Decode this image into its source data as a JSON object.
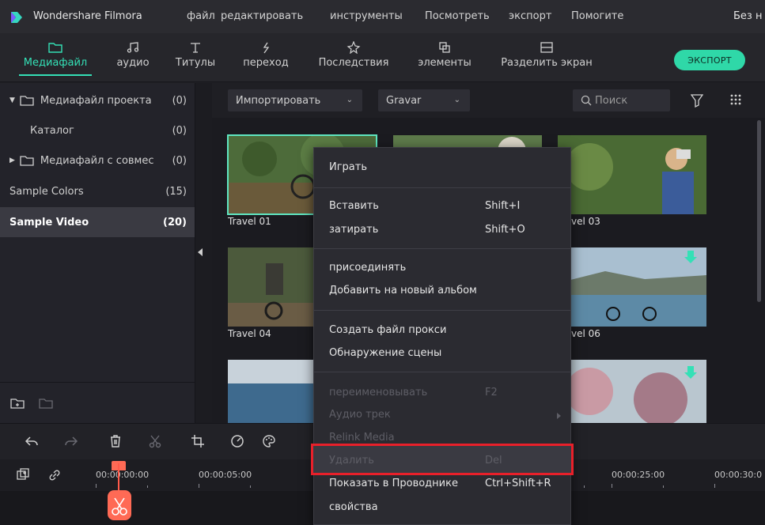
{
  "app": {
    "name": "Wondershare Filmora",
    "untitled": "Без н"
  },
  "menu": [
    "файл",
    "редактировать",
    "инструменты",
    "Посмотреть",
    "экспорт",
    "Помогите"
  ],
  "tabs": [
    {
      "label": "Медиафайл",
      "icon": "folder-icon",
      "active": true
    },
    {
      "label": "аудио",
      "icon": "music-note-icon",
      "active": false
    },
    {
      "label": "Титулы",
      "icon": "text-t-icon",
      "active": false
    },
    {
      "label": "переход",
      "icon": "transition-icon",
      "active": false
    },
    {
      "label": "Последствия",
      "icon": "effects-sparkle-icon",
      "active": false
    },
    {
      "label": "элементы",
      "icon": "elements-icon",
      "active": false
    },
    {
      "label": "Разделить экран",
      "icon": "split-screen-icon",
      "active": false
    }
  ],
  "export_label": "ЭКСПОРТ",
  "library": [
    {
      "label": "Медиафайл проекта",
      "count": "(0)",
      "expand": "▼",
      "folder": true
    },
    {
      "label": "Каталог",
      "count": "(0)",
      "expand": "",
      "folder": false
    },
    {
      "label": "Медиафайл с совмес",
      "count": "(0)",
      "expand": "▶",
      "folder": true
    },
    {
      "label": "Sample Colors",
      "count": "(15)",
      "expand": "",
      "folder": false
    },
    {
      "label": "Sample Video",
      "count": "(20)",
      "expand": "",
      "folder": false,
      "selected": true
    }
  ],
  "media_bar": {
    "import_label": "Импортировать",
    "gravar_label": "Gravar",
    "search_placeholder": "Поиск"
  },
  "thumbnails": [
    {
      "label": "Travel 01"
    },
    {
      "label": "vel 03"
    },
    {
      "label": "Travel 04"
    },
    {
      "label": "vel 06"
    }
  ],
  "context_menu": [
    {
      "label": "Играть",
      "shortcut": "",
      "disabled": false
    },
    {
      "label": "Вставить",
      "shortcut": "Shift+I",
      "disabled": false
    },
    {
      "label": "затирать",
      "shortcut": "Shift+O",
      "disabled": false
    },
    {
      "label": "присоединять",
      "shortcut": "",
      "disabled": false
    },
    {
      "label": "Добавить на новый альбом",
      "shortcut": "",
      "disabled": false
    },
    {
      "label": "Создать файл прокси",
      "shortcut": "",
      "disabled": false
    },
    {
      "label": "Обнаружение сцены",
      "shortcut": "",
      "disabled": false
    },
    {
      "label": "переименовывать",
      "shortcut": "F2",
      "disabled": true
    },
    {
      "label": "Аудио трек",
      "shortcut": "",
      "disabled": true
    },
    {
      "label": "Relink Media",
      "shortcut": "",
      "disabled": true
    },
    {
      "label": "Удалить",
      "shortcut": "Del",
      "disabled": true
    },
    {
      "label": "Показать в Проводнике",
      "shortcut": "Ctrl+Shift+R",
      "disabled": false
    },
    {
      "label": "свойства",
      "shortcut": "",
      "disabled": false
    }
  ],
  "timeline": {
    "times": [
      "00:00:00:00",
      "00:00:05:00",
      "00:00:25:00",
      "00:00:30:0"
    ]
  },
  "colors": {
    "accent": "#34e0b6",
    "export": "#2fd8a8",
    "playhead": "#ff6a55",
    "highlight_border": "#e8202a"
  }
}
